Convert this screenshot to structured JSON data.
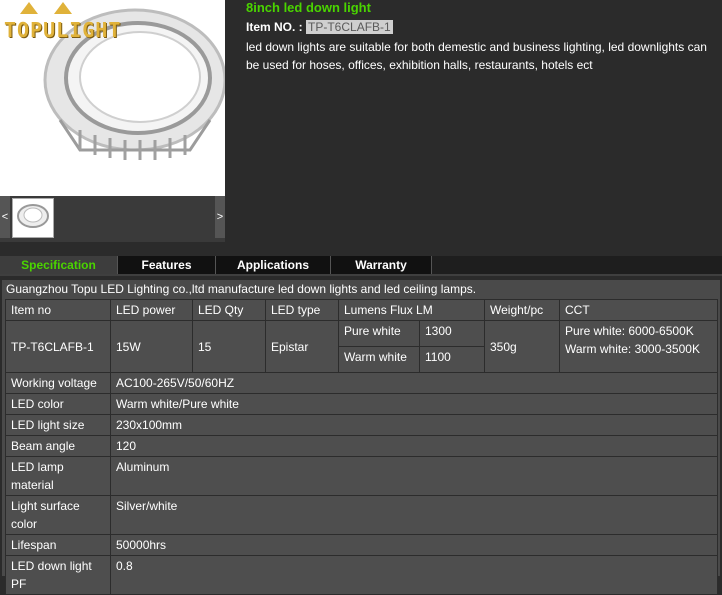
{
  "brand": {
    "logo_text": "TOPULIGHT"
  },
  "gallery": {
    "prev_label": "<",
    "next_label": ">"
  },
  "product": {
    "title": "8inch led down light",
    "item_no_label": "Item NO. :",
    "item_no": "TP-T6CLAFB-1",
    "description": "led down lights are suitable for both demestic and business lighting, led downlights can be used for hoses, offices, exhibition halls, restaurants, hotels ect"
  },
  "tabs": [
    "Specification",
    "Features",
    "Applications",
    "Warranty"
  ],
  "spec": {
    "intro": "Guangzhou Topu LED Lighting co.,ltd manufacture led down lights and led ceiling lamps.",
    "headers": [
      "Item no",
      "LED power",
      "LED Qty",
      "LED type",
      "Lumens Flux LM",
      "Weight/pc",
      "CCT"
    ],
    "main_row": {
      "item_no": "TP-T6CLAFB-1",
      "power": "15W",
      "qty": "15",
      "type": "Epistar",
      "flux": [
        {
          "name": "Pure white",
          "value": "1300"
        },
        {
          "name": "Warm white",
          "value": "1100"
        }
      ],
      "weight": "350g",
      "cct": [
        "Pure white: 6000-6500K",
        "Warm white: 3000-3500K"
      ]
    },
    "rows": [
      {
        "label": "Working voltage",
        "value": "AC100-265V/50/60HZ"
      },
      {
        "label": "LED color",
        "value": "Warm white/Pure white"
      },
      {
        "label": "LED light size",
        "value": " 230x100mm"
      },
      {
        "label": "Beam angle",
        "value": "120"
      },
      {
        "label": "LED lamp material",
        "value": "Aluminum"
      },
      {
        "label": "Light surface color",
        "value": "Silver/white"
      },
      {
        "label": "Lifespan",
        "value": "50000hrs"
      },
      {
        "label": "LED down light PF",
        "value": "0.8"
      }
    ]
  }
}
